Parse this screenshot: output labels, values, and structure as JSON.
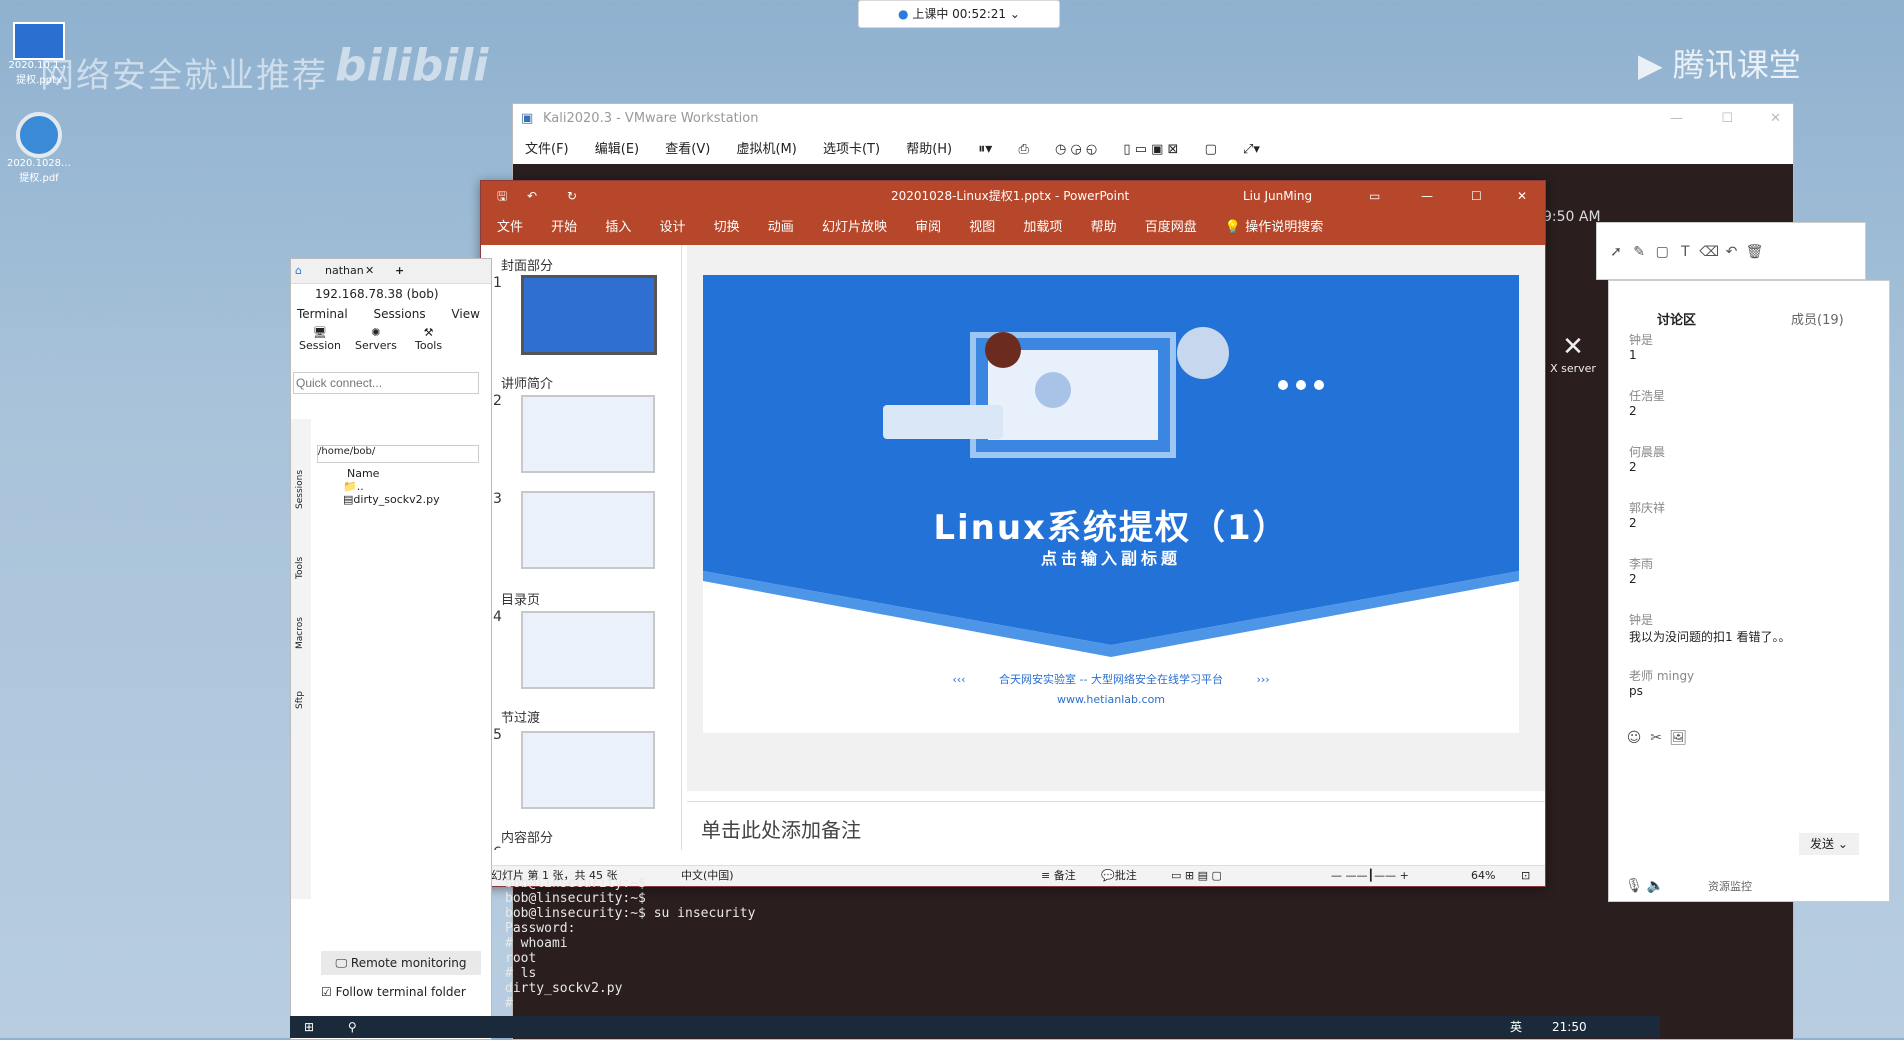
{
  "class_bar": {
    "status": "上课中 00:52:21"
  },
  "watermark": {
    "course": "网络安全就业推荐",
    "site": "bilibili",
    "brand": "腾讯课堂"
  },
  "desktop": {
    "icon1_label": "2020.10.1…\n提权.pptx",
    "icon2_label": "2020.1028…\n提权.pdf"
  },
  "vmware": {
    "title": "Kali2020.3 - VMware Workstation",
    "menu": [
      "文件(F)",
      "编辑(E)",
      "查看(V)",
      "虚拟机(M)",
      "选项卡(T)",
      "帮助(H)"
    ],
    "clock": "9:50 AM"
  },
  "ppt": {
    "title": "20201028-Linux提权1.pptx - PowerPoint",
    "user": "Liu JunMing",
    "tabs": [
      "文件",
      "开始",
      "插入",
      "设计",
      "切换",
      "动画",
      "幻灯片放映",
      "审阅",
      "视图",
      "加载项",
      "帮助",
      "百度网盘",
      "操作说明搜索"
    ],
    "sections": [
      "封面部分",
      "讲师简介",
      "目录页",
      "节过渡",
      "内容部分"
    ],
    "slide_numbers": [
      "1",
      "2",
      "3",
      "4",
      "5",
      "6"
    ],
    "slide_title": "Linux系统提权（1）",
    "slide_subtitle": "点击输入副标题",
    "slide_footer": "合天网安实验室 -- 大型网络安全在线学习平台",
    "slide_url": "www.hetianlab.com",
    "notes_placeholder": "单击此处添加备注",
    "status_left": "幻灯片 第 1 张，共 45 张",
    "status_lang": "中文(中国)",
    "status_notes": "备注",
    "status_comments": "批注",
    "zoom": "64%"
  },
  "mobaxterm": {
    "tab": "nathan",
    "host": "192.168.78.38 (bob)",
    "menu": [
      "Terminal",
      "Sessions",
      "View"
    ],
    "toolbar": [
      "Session",
      "Servers",
      "Tools"
    ],
    "quick_connect": "Quick connect...",
    "path": "/home/bob/",
    "col_name": "Name",
    "files": [
      "..",
      "dirty_sockv2.py"
    ],
    "side_tabs": [
      "Sessions",
      "Tools",
      "Macros",
      "Sftp"
    ],
    "remote_monitoring": "Remote monitoring",
    "follow_folder": "Follow terminal folder",
    "xserver": "X server"
  },
  "terminal": {
    "lines": [
      "bob@linsecurity:~$",
      "bob@linsecurity:~$",
      "bob@linsecurity:~$ su insecurity",
      "Password:",
      "# whoami",
      "root",
      "# ls",
      "dirty_sockv2.py",
      "# "
    ]
  },
  "chat": {
    "tab_discuss": "讨论区",
    "tab_members": "成员(19)",
    "messages": [
      {
        "name": "钟是",
        "text": "1"
      },
      {
        "name": "任浩星",
        "text": "2"
      },
      {
        "name": "何晨晨",
        "text": "2"
      },
      {
        "name": "郭庆祥",
        "text": "2"
      },
      {
        "name": "李雨",
        "text": "2"
      },
      {
        "name": "钟是",
        "text": "我以为没问题的扣1  看错了。。"
      },
      {
        "name": "老师 mingy",
        "text": "ps"
      }
    ],
    "send": "发送",
    "monitor": "资源监控"
  },
  "taskbar": {
    "time": "21:50",
    "ime": "英"
  }
}
